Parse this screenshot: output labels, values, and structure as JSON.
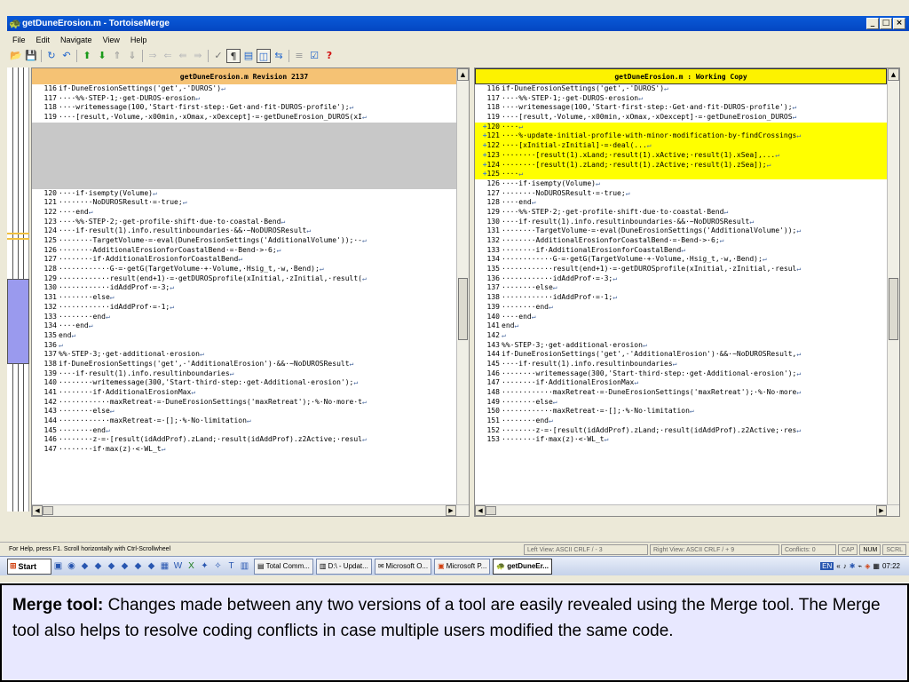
{
  "window": {
    "title": "getDuneErosion.m - TortoiseMerge",
    "buttons": [
      "_",
      "□",
      "×"
    ]
  },
  "menu": [
    "File",
    "Edit",
    "Navigate",
    "View",
    "Help"
  ],
  "toolbar_icons": [
    "open-icon",
    "save-icon",
    "refresh-icon",
    "undo-icon",
    "next-diff-icon",
    "prev-diff-icon",
    "first-diff-icon",
    "last-diff-icon",
    "next-conflict-icon",
    "prev-conflict-icon",
    "use-left-icon",
    "use-right-icon",
    "use-both-icon",
    "whitespace-icon",
    "one-pane-icon",
    "two-pane-icon",
    "switch-icon",
    "patch-icon",
    "settings-icon",
    "help-icon"
  ],
  "left": {
    "header": "getDuneErosion.m Revision 2137",
    "lines": [
      {
        "n": "116",
        "t": "if·DuneErosionSettings('get',·'DUROS')"
      },
      {
        "n": "117",
        "t": "····%%·STEP·1;·get·DUROS·erosion"
      },
      {
        "n": "118",
        "t": "····writemessage(100,'Start·first·step:·Get·and·fit·DUROS·profile');"
      },
      {
        "n": "119",
        "t": "····[result,·Volume,·x00min,·xOmax,·xOexcept]·=·getDuneErosion_DUROS(xI"
      },
      {
        "n": "",
        "t": "",
        "empty": true
      },
      {
        "n": "",
        "t": "",
        "empty": true
      },
      {
        "n": "",
        "t": "",
        "empty": true
      },
      {
        "n": "",
        "t": "",
        "empty": true
      },
      {
        "n": "",
        "t": "",
        "empty": true
      },
      {
        "n": "",
        "t": "",
        "empty": true
      },
      {
        "n": "",
        "t": "",
        "empty": true
      },
      {
        "n": "120",
        "t": "····if·isempty(Volume)"
      },
      {
        "n": "121",
        "t": "········NoDUROSResult·=·true;"
      },
      {
        "n": "122",
        "t": "····end"
      },
      {
        "n": "123",
        "t": "····%%·STEP·2;·get·profile·shift·due·to·coastal·Bend"
      },
      {
        "n": "124",
        "t": "····if·result(1).info.resultinboundaries·&&·~NoDUROSResult"
      },
      {
        "n": "125",
        "t": "········TargetVolume·=·eval(DuneErosionSettings('AdditionalVolume'));·-"
      },
      {
        "n": "126",
        "t": "········AdditionalErosionforCoastalBend·=·Bend·>·6;"
      },
      {
        "n": "127",
        "t": "········if·AdditionalErosionforCoastalBend"
      },
      {
        "n": "128",
        "t": "············G·=·getG(TargetVolume·+·Volume,·Hsig_t,·w,·Bend);"
      },
      {
        "n": "129",
        "t": "············result(end+1)·=·getDUROSprofile(xInitial,·zInitial,·result("
      },
      {
        "n": "130",
        "t": "············idAddProf·=·3;"
      },
      {
        "n": "131",
        "t": "········else"
      },
      {
        "n": "132",
        "t": "············idAddProf·=·1;"
      },
      {
        "n": "133",
        "t": "········end"
      },
      {
        "n": "134",
        "t": "····end"
      },
      {
        "n": "135",
        "t": "end"
      },
      {
        "n": "136",
        "t": ""
      },
      {
        "n": "137",
        "t": "%%·STEP·3;·get·additional·erosion"
      },
      {
        "n": "138",
        "t": "if·DuneErosionSettings('get',·'AdditionalErosion')·&&·~NoDUROSResult"
      },
      {
        "n": "139",
        "t": "····if·result(1).info.resultinboundaries"
      },
      {
        "n": "140",
        "t": "········writemessage(300,'Start·third·step:·get·Additional·erosion');"
      },
      {
        "n": "141",
        "t": "········if·AdditionalErosionMax"
      },
      {
        "n": "142",
        "t": "············maxRetreat·=·DuneErosionSettings('maxRetreat');·%·No·more·t"
      },
      {
        "n": "143",
        "t": "········else"
      },
      {
        "n": "144",
        "t": "············maxRetreat·=·[];·%·No·limitation"
      },
      {
        "n": "145",
        "t": "········end"
      },
      {
        "n": "146",
        "t": "········z·=·[result(idAddProf).zLand;·result(idAddProf).z2Active;·resul"
      },
      {
        "n": "147",
        "t": "········if·max(z)·<·WL_t"
      }
    ]
  },
  "right": {
    "header": "getDuneErosion.m : Working Copy",
    "lines": [
      {
        "n": "116",
        "t": "if·DuneErosionSettings('get',·'DUROS')"
      },
      {
        "n": "117",
        "t": "····%%·STEP·1;·get·DUROS·erosion"
      },
      {
        "n": "118",
        "t": "····writemessage(100,'Start·first·step:·Get·and·fit·DUROS·profile');"
      },
      {
        "n": "119",
        "t": "····[result,·Volume,·x00min,·xOmax,·xOexcept]·=·getDuneErosion_DUROS"
      },
      {
        "n": "120",
        "t": "····",
        "add": true
      },
      {
        "n": "121",
        "t": "····%·update·initial·profile·with·minor·modification·by·findCrossings",
        "add": true
      },
      {
        "n": "122",
        "t": "····[xInitial·zInitial]·=·deal(...",
        "add": true
      },
      {
        "n": "123",
        "t": "········[result(1).xLand;·result(1).xActive;·result(1).xSea],...",
        "add": true
      },
      {
        "n": "124",
        "t": "········[result(1).zLand;·result(1).zActive;·result(1).zSea]);",
        "add": true
      },
      {
        "n": "125",
        "t": "····",
        "add": true
      },
      {
        "n": "126",
        "t": "····if·isempty(Volume)"
      },
      {
        "n": "127",
        "t": "········NoDUROSResult·=·true;"
      },
      {
        "n": "128",
        "t": "····end"
      },
      {
        "n": "129",
        "t": "····%%·STEP·2;·get·profile·shift·due·to·coastal·Bend"
      },
      {
        "n": "130",
        "t": "····if·result(1).info.resultinboundaries·&&·~NoDUROSResult"
      },
      {
        "n": "131",
        "t": "········TargetVolume·=·eval(DuneErosionSettings('AdditionalVolume'));"
      },
      {
        "n": "132",
        "t": "········AdditionalErosionforCoastalBend·=·Bend·>·6;"
      },
      {
        "n": "133",
        "t": "········if·AdditionalErosionforCoastalBend"
      },
      {
        "n": "134",
        "t": "············G·=·getG(TargetVolume·+·Volume,·Hsig_t,·w,·Bend);"
      },
      {
        "n": "135",
        "t": "············result(end+1)·=·getDUROSprofile(xInitial,·zInitial,·resul"
      },
      {
        "n": "136",
        "t": "············idAddProf·=·3;"
      },
      {
        "n": "137",
        "t": "········else"
      },
      {
        "n": "138",
        "t": "············idAddProf·=·1;"
      },
      {
        "n": "139",
        "t": "········end"
      },
      {
        "n": "140",
        "t": "····end"
      },
      {
        "n": "141",
        "t": "end"
      },
      {
        "n": "142",
        "t": ""
      },
      {
        "n": "143",
        "t": "%%·STEP·3;·get·additional·erosion"
      },
      {
        "n": "144",
        "t": "if·DuneErosionSettings('get',·'AdditionalErosion')·&&·~NoDUROSResult,"
      },
      {
        "n": "145",
        "t": "····if·result(1).info.resultinboundaries"
      },
      {
        "n": "146",
        "t": "········writemessage(300,'Start·third·step:·get·Additional·erosion');"
      },
      {
        "n": "147",
        "t": "········if·AdditionalErosionMax"
      },
      {
        "n": "148",
        "t": "············maxRetreat·=·DuneErosionSettings('maxRetreat');·%·No·more"
      },
      {
        "n": "149",
        "t": "········else"
      },
      {
        "n": "150",
        "t": "············maxRetreat·=·[];·%·No·limitation"
      },
      {
        "n": "151",
        "t": "········end"
      },
      {
        "n": "152",
        "t": "········z·=·[result(idAddProf).zLand;·result(idAddProf).z2Active;·res"
      },
      {
        "n": "153",
        "t": "········if·max(z)·<·WL_t"
      }
    ]
  },
  "status": {
    "help": "For Help, press F1. Scroll horizontally with Ctrl-Scrollwheel",
    "left_view": "Left View: ASCII CRLF  / - 3",
    "right_view": "Right View: ASCII CRLF  / + 9",
    "conflicts": "Conflicts: 0",
    "cap": "CAP",
    "num": "NUM",
    "scrl": "SCRL"
  },
  "taskbar": {
    "start": "Start",
    "tasks": [
      {
        "label": "Total Comm...",
        "active": false
      },
      {
        "label": "D:\\ - Updat...",
        "active": false
      },
      {
        "label": "Microsoft O...",
        "active": false
      },
      {
        "label": "Microsoft P...",
        "active": false
      },
      {
        "label": "getDuneEr...",
        "active": true
      }
    ],
    "lang": "EN",
    "clock": "07:22"
  },
  "caption": {
    "bold": "Merge tool:",
    "text": " Changes made between any two versions of a tool are easily revealed using the Merge tool. The Merge tool also helps to resolve coding conflicts in case multiple users modified the same code."
  },
  "colors": {
    "left_header": "#f5c274",
    "right_header": "#fdf200",
    "added_line": "#ffff00",
    "empty_line": "#c8c8c8",
    "caption_bg": "#e8e8ff"
  }
}
